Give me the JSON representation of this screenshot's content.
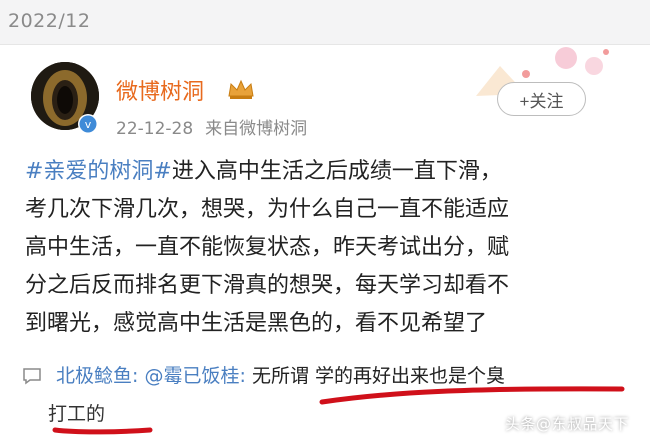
{
  "top_bar": {
    "date": "2022/12"
  },
  "post": {
    "author": "微博树洞",
    "time": "22-12-28",
    "source": "来自微博树洞",
    "follow_label": "+关注",
    "hashtag": "#亲爱的树洞#",
    "lines": [
      "进入高中生活之后成绩一直下滑，",
      "考几次下滑几次，想哭，为什么自己一直不能适应",
      "高中生活，一直不能恢复状态，昨天考试出分，赋",
      "分之后反而排名更下滑真的想哭，每天学习却看不",
      "到曙光，感觉高中生活是黑色的，看不见希望了"
    ]
  },
  "comment": {
    "author": "北极鲶鱼",
    "mention": "@霉已饭桂",
    "line1": "无所谓 学的再好出来也是个臭",
    "line2": "打工的"
  },
  "watermark": "头条@东叔品天下",
  "colors": {
    "brand": "#e86a1e",
    "link": "#4a7fc1",
    "underline": "#d0101a"
  },
  "icons": [
    "crown-icon",
    "verified-icon",
    "comment-icon",
    "party-decoration"
  ]
}
